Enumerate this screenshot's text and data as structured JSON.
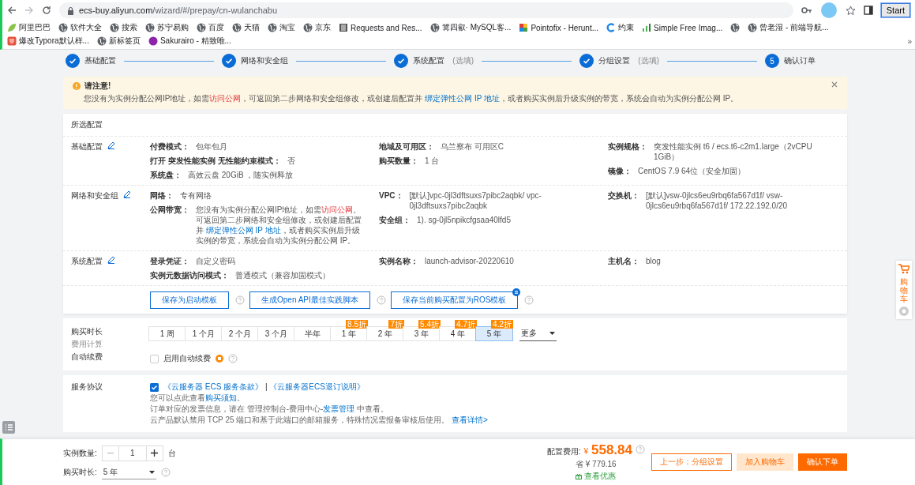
{
  "browser": {
    "host": "ecs-buy.aliyun.com",
    "path": "/wizard/#/prepay/cn-wulanchabu",
    "start_button": "Start",
    "overflow": "»"
  },
  "bookmarks": [
    {
      "kind": "leaf",
      "label": "阿里巴巴"
    },
    {
      "kind": "globe",
      "label": "软件大全"
    },
    {
      "kind": "globe",
      "label": "搜索"
    },
    {
      "kind": "globe",
      "label": "苏宁易购"
    },
    {
      "kind": "globe",
      "label": "百度"
    },
    {
      "kind": "globe",
      "label": "天猫"
    },
    {
      "kind": "globe",
      "label": "淘宝"
    },
    {
      "kind": "globe",
      "label": "京东"
    },
    {
      "kind": "doc",
      "label": "Requests and Res..."
    },
    {
      "kind": "globe",
      "label": "篝四叡· MySQL客..."
    },
    {
      "kind": "pinwheel",
      "label": "Pointofix - Herunt..."
    },
    {
      "kind": "ring",
      "label": "约束"
    },
    {
      "kind": "bars",
      "label": "Simple Free Imag..."
    },
    {
      "kind": "globe"
    },
    {
      "kind": "globe",
      "label": "曾老湿 - 前端导航..."
    },
    {
      "kind": "square",
      "label": "爆改Typora默认样..."
    },
    {
      "kind": "globe",
      "label": "新标签页"
    },
    {
      "kind": "dot",
      "label": "Sakurairo - 精致唯..."
    }
  ],
  "steps": [
    {
      "label": "基础配置",
      "completed": true
    },
    {
      "label": "网络和安全组",
      "completed": true
    },
    {
      "label": "系统配置",
      "hint": "(选填)",
      "completed": true
    },
    {
      "label": "分组设置",
      "hint": "(选填)",
      "completed": true
    },
    {
      "number": "5",
      "label": "确认订单",
      "completed": false
    }
  ],
  "notice": {
    "title": "请注意!",
    "text": [
      {
        "kind": "plain",
        "text": "您没有为实例分配公网IP地址，如需"
      },
      {
        "kind": "warn",
        "text": "访问公网"
      },
      {
        "kind": "plain",
        "text": "，可返回第二步网络和安全组修改，或创建后配置并 "
      },
      {
        "kind": "link",
        "text": "绑定弹性公网 IP 地址"
      },
      {
        "kind": "plain",
        "text": "，或者购买实例后升级实例的带宽，系统会自动为实例分配公网 IP。"
      }
    ]
  },
  "config": {
    "title": "所选配置",
    "sections": [
      {
        "title": "基础配置",
        "columns": [
          [
            {
              "label": "付费模式：",
              "value": "包年包月"
            },
            {
              "label": "打开 突发性能实例 无性能约束模式：",
              "value": "否"
            },
            {
              "label": "系统盘：",
              "value": "高效云盘 20GiB ，随实例释放"
            }
          ],
          [
            {
              "label": "地域及可用区：",
              "value": "乌兰察布 可用区C"
            },
            {
              "label": "购买数量：",
              "value": "1 台"
            }
          ],
          [
            {
              "label": "实例规格：",
              "value": "突发性能实例 t6 / ecs.t6-c2m1.large（2vCPU 1GiB）"
            },
            {
              "label": "镜像：",
              "value": "CentOS 7.9 64位（安全加固）"
            }
          ]
        ]
      },
      {
        "title": "网络和安全组",
        "columns": [
          [
            {
              "label": "网络：",
              "value": "专有网络"
            },
            {
              "label": "公网带宽：",
              "value": [
                {
                  "kind": "plain",
                  "text": "您没有为实例分配公网IP地址，如需"
                },
                {
                  "kind": "warn",
                  "text": "访问公网"
                },
                {
                  "kind": "plain",
                  "text": "。可返回第二步网络和安全组修改，或创建后配置并 "
                },
                {
                  "kind": "link",
                  "text": "绑定弹性公网 IP 地址"
                },
                {
                  "kind": "plain",
                  "text": "，或者购买实例后升级实例的带宽，系统会自动为实例分配公网 IP。"
                }
              ]
            }
          ],
          [
            {
              "label": "VPC：",
              "value": "[默认]vpc-0jl3dftsuxs7pibc2aqbk/ vpc-0jl3dftsuxs7pibc2aqbk"
            },
            {
              "label": "安全组：",
              "value": "1). sg-0jl5npikcfgsaa40lfd5"
            }
          ],
          [
            {
              "label": "交换机：",
              "value": "[默认]vsw-0jlcs6eu9rbq6fa567d1f/ vsw-0jlcs6eu9rbq6fa567d1f/ 172.22.192.0/20"
            }
          ]
        ]
      },
      {
        "title": "系统配置",
        "columns": [
          [
            {
              "label": "登录凭证：",
              "value": "自定义密码"
            },
            {
              "label": "实例元数据访问模式：",
              "value": "普通模式（兼容加固模式）"
            }
          ],
          [
            {
              "label": "实例名称：",
              "value": "launch-advisor-20220610"
            }
          ],
          [
            {
              "label": "主机名：",
              "value": "blog"
            }
          ]
        ]
      }
    ],
    "buttons": [
      {
        "label": "保存为启动模板"
      },
      {
        "label": "生成Open API最佳实践脚本"
      },
      {
        "label": "保存当前购买配置为ROS模板",
        "badge": true
      }
    ]
  },
  "duration": {
    "label": "购买时长",
    "sub_label": "费用计算",
    "options": [
      {
        "label": "1 周",
        "selected": false
      },
      {
        "label": "1 个月",
        "selected": false
      },
      {
        "label": "2 个月",
        "selected": false
      },
      {
        "label": "3 个月",
        "selected": false
      },
      {
        "label": "半年",
        "selected": false
      },
      {
        "label": "1 年",
        "discount": "8.5折",
        "selected": false
      },
      {
        "label": "2 年",
        "discount": "7折",
        "selected": false
      },
      {
        "label": "3 年",
        "discount": "5.4折",
        "selected": false
      },
      {
        "label": "4 年",
        "discount": "4.7折",
        "selected": false
      },
      {
        "label": "5 年",
        "discount": "4.2折",
        "selected": true
      }
    ],
    "more": "更多",
    "auto_renew": {
      "label": "自动续费",
      "option": "启用自动续费",
      "checked": false
    }
  },
  "agreement": {
    "label": "服务协议",
    "checked": true,
    "links": [
      {
        "kind": "link",
        "text": "《云服务器 ECS 服务条款》"
      },
      {
        "kind": "plain",
        "text": " | "
      },
      {
        "kind": "link",
        "text": "《云服务器ECS退订说明》"
      }
    ],
    "lines": [
      [
        {
          "kind": "plain",
          "text": "您可以点此查看"
        },
        {
          "kind": "link",
          "text": "购买须知"
        },
        {
          "kind": "plain",
          "text": "。"
        }
      ],
      [
        {
          "kind": "plain",
          "text": "订单对应的发票信息，请在 管理控制台-费用中心-"
        },
        {
          "kind": "link",
          "text": "发票管理"
        },
        {
          "kind": "plain",
          "text": " 中查看。"
        }
      ],
      [
        {
          "kind": "plain",
          "text": "云产品默认禁用 TCP 25 端口和基于此端口的邮箱服务，特殊情况需报备审核后使用。 "
        },
        {
          "kind": "link",
          "text": "查看详情>"
        }
      ]
    ]
  },
  "order": {
    "quantity_label": "实例数量:",
    "quantity": "1",
    "unit": "台",
    "duration_label": "购买时长:",
    "duration": "5 年",
    "price_label": "配置费用:",
    "currency": "¥",
    "price": "558.84",
    "saving": "省 ¥ 779.16",
    "offers_link": "查看优惠",
    "buttons": [
      {
        "label": "上一步：分组设置",
        "kind": "secondary"
      },
      {
        "label": "加入购物车",
        "kind": "light"
      },
      {
        "label": "确认下单",
        "kind": "primary"
      }
    ]
  },
  "side_cart": {
    "label": "购物车"
  }
}
